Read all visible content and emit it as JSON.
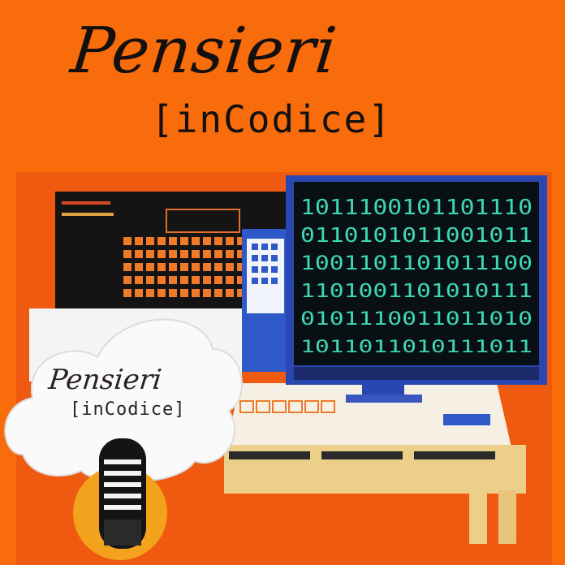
{
  "logo": {
    "title_script": "Pensieri",
    "title_code": "[inCodice]",
    "badge_script": "Pensieri",
    "badge_code": "[inCodice]"
  },
  "colors": {
    "background": "#f86c0c",
    "text": "#141010",
    "monitor_frame": "#2a46b0",
    "code_green": "#3fd6b4",
    "desk": "#f6f0e0"
  },
  "screen_code_rows": [
    "1011100101101110",
    "0110101011001011",
    "1001101101011100",
    "1101001101010111",
    "0101110011011010",
    "1011011010111011"
  ]
}
